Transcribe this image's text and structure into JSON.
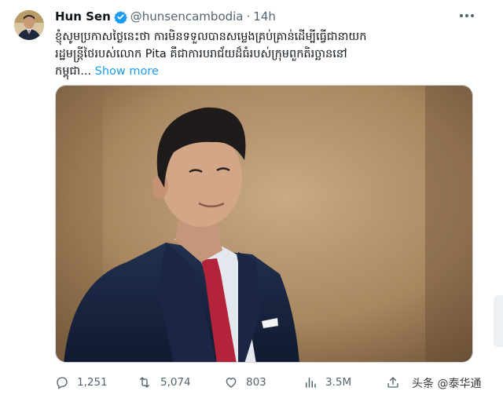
{
  "tweet": {
    "author": {
      "display_name": "Hun Sen",
      "handle": "@hunsencambodia",
      "verified": true,
      "avatar_icon": "profile-photo"
    },
    "separator": "·",
    "time": "14h",
    "text_lines": [
      "ខ្ញុំសូមប្រកាសថ្ងៃនេះថា ការមិនទទួលបានសម្លេងគ្រប់គ្រាន់ដើម្បីធ្វើជានាយក",
      "រដ្ឋមន្ត្រីថៃរបស់លោក Pita គឺជាការបរាជ័យដ៏ធំរបស់ក្រុមពួកតិរច្ឆាននៅ",
      "កម្ពុជា..."
    ],
    "show_more": "Show more",
    "media": {
      "type": "photo"
    },
    "actions": {
      "replies": "1,251",
      "retweets": "5,074",
      "likes": "803",
      "views": "3.5M"
    }
  },
  "watermark": "头条 @泰华通",
  "colors": {
    "accent": "#1d9bf0",
    "text": "#0f1419",
    "muted": "#536471"
  }
}
